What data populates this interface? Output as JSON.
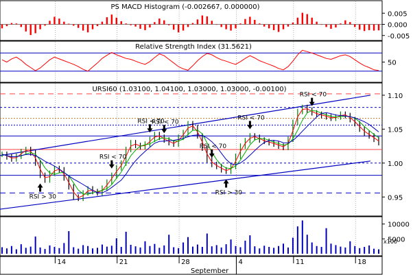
{
  "colors": {
    "price_up": "#008000",
    "price_down": "#000000",
    "ma_red": "#ff0000",
    "ma_green": "#00b000",
    "ma_blue": "#0000c0",
    "trend": "#0000c0",
    "rsi_line": "#ff0000",
    "macd_bar": "#ff0000",
    "volume_bar": "#0000c0",
    "resistance": "#ff4040",
    "support_mid": "#c08040",
    "dotted_level": "#0000c0",
    "signal_arrow": "#000000"
  },
  "chart_data": [
    {
      "type": "bar",
      "panel": "macd_histogram",
      "title": "PS MACD Histogram (-0.002667, 0.000000)",
      "ylim": [
        -0.006,
        0.006
      ],
      "yticks": [
        "0.005",
        "0.000",
        "-0.005"
      ],
      "series": [
        {
          "name": "MACD Histogram",
          "values": [
            -0.0018,
            -0.0008,
            0.0006,
            0.0004,
            -0.0012,
            -0.0032,
            -0.0048,
            -0.004,
            -0.0022,
            -0.0006,
            0.0016,
            0.0034,
            0.0026,
            0.0012,
            0.0003,
            -0.0006,
            -0.0016,
            -0.0028,
            -0.0036,
            -0.0022,
            -0.0008,
            0.0012,
            0.0032,
            0.0044,
            0.003,
            0.0014,
            0.0004,
            -0.0004,
            -0.001,
            -0.002,
            -0.0026,
            -0.0014,
            0.001,
            0.0026,
            0.0018,
            -0.0004,
            -0.0024,
            -0.0036,
            -0.0028,
            -0.0012,
            0.0006,
            0.0022,
            0.004,
            0.0036,
            0.0016,
            -0.0002,
            -0.0012,
            -0.0022,
            -0.0028,
            -0.0018,
            0.0004,
            0.0024,
            0.0034,
            0.002,
            0.0004,
            -0.001,
            -0.0018,
            -0.0026,
            -0.0034,
            -0.0022,
            -0.001,
            0.0008,
            0.003,
            0.0052,
            0.0046,
            0.003,
            0.0012,
            -0.0002,
            -0.0012,
            -0.002,
            -0.0014,
            0.0004,
            0.0018,
            0.001,
            -0.0012,
            -0.0024,
            -0.003,
            -0.0026,
            -0.0028,
            -0.0027
          ]
        }
      ]
    },
    {
      "type": "line",
      "panel": "rsi",
      "title": "Relative Strength Index (31.5621)",
      "ylim": [
        10,
        90
      ],
      "yticks": [
        "50"
      ],
      "levels": [
        70,
        30
      ],
      "series": [
        {
          "name": "Relative Strength Index",
          "values": [
            55,
            50,
            57,
            61,
            54,
            45,
            38,
            31,
            37,
            46,
            55,
            61,
            57,
            53,
            49,
            45,
            40,
            34,
            30,
            39,
            48,
            58,
            65,
            71,
            66,
            62,
            58,
            56,
            52,
            48,
            45,
            51,
            60,
            68,
            64,
            56,
            48,
            40,
            35,
            32,
            42,
            53,
            62,
            69,
            66,
            60,
            55,
            52,
            48,
            45,
            51,
            58,
            64,
            59,
            53,
            49,
            45,
            41,
            36,
            33,
            40,
            52,
            66,
            76,
            73,
            70,
            66,
            62,
            58,
            56,
            60,
            64,
            66,
            62,
            55,
            48,
            42,
            38,
            33,
            31.6
          ]
        }
      ]
    },
    {
      "type": "line",
      "panel": "price",
      "title": "URSI60 (1.03100, 1.04100, 1.03000, 1.03000, -0.00100)",
      "ylim": [
        0.925,
        1.115
      ],
      "yticks": [
        "1.10",
        "1.05",
        "1.00",
        "0.95"
      ],
      "xticks": [
        "14",
        "21",
        "28",
        "4",
        "11",
        "18"
      ],
      "xlabel": "September",
      "series": [
        {
          "name": "URSI60",
          "values": [
            1.013,
            1.009,
            1.006,
            1.01,
            1.017,
            1.02,
            1.015,
            1.0,
            0.982,
            0.975,
            0.985,
            0.992,
            0.99,
            0.978,
            0.965,
            0.95,
            0.948,
            0.956,
            0.962,
            0.958,
            0.956,
            0.963,
            0.972,
            0.982,
            0.993,
            1.0,
            1.02,
            1.03,
            1.026,
            1.024,
            1.028,
            1.035,
            1.042,
            1.038,
            1.034,
            1.03,
            1.028,
            1.038,
            1.045,
            1.058,
            1.052,
            1.04,
            1.022,
            1.005,
            0.998,
            0.995,
            0.99,
            0.988,
            0.995,
            1.01,
            1.025,
            1.033,
            1.04,
            1.038,
            1.034,
            1.032,
            1.03,
            1.028,
            1.025,
            1.023,
            1.035,
            1.06,
            1.076,
            1.082,
            1.078,
            1.074,
            1.072,
            1.07,
            1.068,
            1.066,
            1.068,
            1.072,
            1.07,
            1.064,
            1.058,
            1.05,
            1.044,
            1.04,
            1.035,
            1.03
          ]
        }
      ],
      "annotations": [
        "RSI > 30",
        "RSI < 70",
        "RSI < 70",
        "RSI < 70",
        "RSI < 70",
        "RSI < 70",
        "RSI > 30",
        "RSI < 70"
      ]
    },
    {
      "type": "bar",
      "panel": "volume",
      "ylim": [
        0,
        12000
      ],
      "yticks": [
        "10000",
        "5000"
      ],
      "axis_unit": "x100",
      "series": [
        {
          "name": "Volume",
          "values": [
            2200,
            1800,
            2600,
            1500,
            3200,
            2000,
            2400,
            5800,
            2100,
            1600,
            2800,
            2300,
            1900,
            3600,
            7600,
            2200,
            1700,
            2900,
            2600,
            1800,
            2000,
            3100,
            2400,
            2700,
            5200,
            2300,
            7400,
            3000,
            2500,
            2100,
            4200,
            2600,
            3300,
            2000,
            2800,
            6400,
            2200,
            1900,
            3800,
            5600,
            2400,
            3100,
            2300,
            6800,
            2500,
            2900,
            2100,
            3200,
            4800,
            2600,
            2200,
            4400,
            6200,
            2500,
            1800,
            2700,
            2300,
            2000,
            2600,
            3400,
            2100,
            5400,
            9200,
            11200,
            6400,
            3800,
            2600,
            2300,
            8600,
            3400,
            2900,
            2400,
            2100,
            4200,
            2600,
            1900,
            2300,
            2800,
            1700,
            1500
          ]
        }
      ]
    }
  ]
}
